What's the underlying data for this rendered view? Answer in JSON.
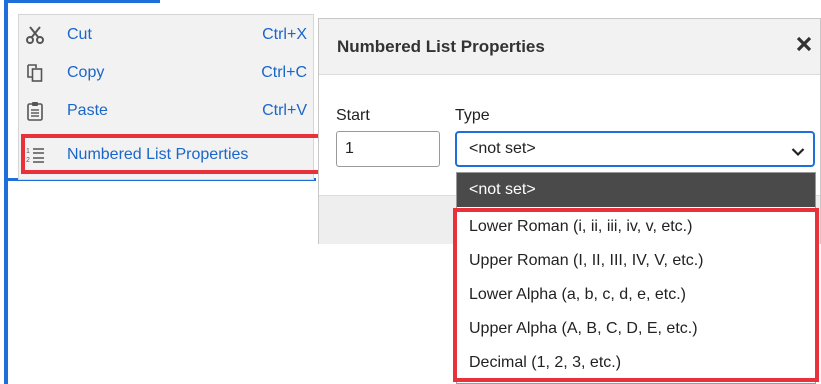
{
  "context_menu": {
    "items": [
      {
        "label": "Cut",
        "shortcut": "Ctrl+X",
        "icon": "scissors-icon"
      },
      {
        "label": "Copy",
        "shortcut": "Ctrl+C",
        "icon": "copy-icon"
      },
      {
        "label": "Paste",
        "shortcut": "Ctrl+V",
        "icon": "paste-icon"
      },
      {
        "label": "Numbered List Properties",
        "shortcut": "",
        "icon": "numbered-list-icon"
      }
    ]
  },
  "dialog": {
    "title": "Numbered List Properties",
    "start_label": "Start",
    "start_value": "1",
    "type_label": "Type",
    "type_value": "<not set>"
  },
  "dropdown": {
    "options": [
      "<not set>",
      "Lower Roman (i, ii, iii, iv, v, etc.)",
      "Upper Roman (I, II, III, IV, V, etc.)",
      "Lower Alpha (a, b, c, d, e, etc.)",
      "Upper Alpha (A, B, C, D, E, etc.)",
      "Decimal (1, 2, 3, etc.)"
    ],
    "selected_index": 0
  },
  "colors": {
    "link_blue": "#1a66c9",
    "highlight_red": "#e8313a",
    "frame_blue": "#1e6fd9",
    "selected_option_bg": "#4a4a4a"
  }
}
